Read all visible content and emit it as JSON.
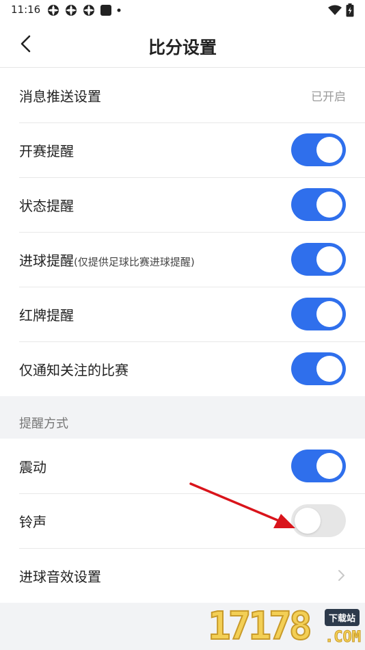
{
  "status_bar": {
    "time": "11:16",
    "icons": [
      "app-notification-icon",
      "app-notification-icon",
      "app-notification-icon",
      "square-notification-icon",
      "dot-icon",
      "wifi-icon",
      "battery-icon"
    ]
  },
  "header": {
    "title": "比分设置"
  },
  "push_settings": {
    "label": "消息推送设置",
    "value": "已开启"
  },
  "notifications": [
    {
      "label": "开赛提醒",
      "note": "",
      "on": true
    },
    {
      "label": "状态提醒",
      "note": "",
      "on": true
    },
    {
      "label": "进球提醒",
      "note": "(仅提供足球比赛进球提醒)",
      "on": true
    },
    {
      "label": "红牌提醒",
      "note": "",
      "on": true
    },
    {
      "label": "仅通知关注的比赛",
      "note": "",
      "on": true
    }
  ],
  "reminder_section": {
    "title": "提醒方式",
    "items": [
      {
        "label": "震动",
        "on": true
      },
      {
        "label": "铃声",
        "on": false
      }
    ],
    "sound_settings_label": "进球音效设置"
  },
  "watermark": {
    "digits": "17178",
    "tag": "下载站",
    "suffix": ".COM"
  },
  "colors": {
    "accent": "#2f6fec",
    "toggle_off": "#e6e6e6",
    "annotation_arrow": "#d9141b"
  }
}
